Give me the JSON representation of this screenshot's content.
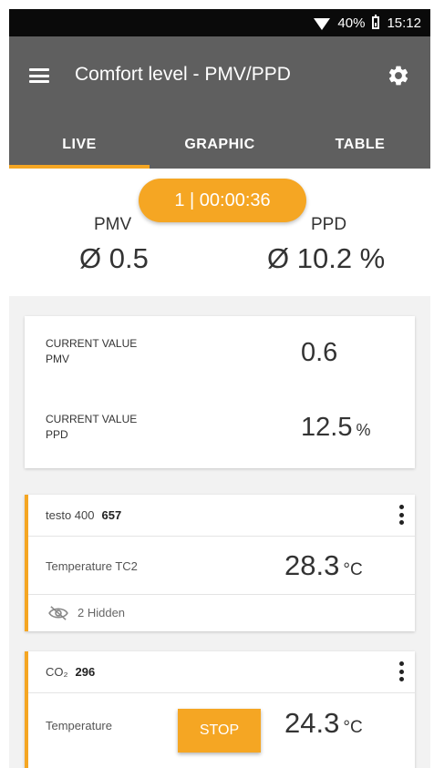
{
  "status_bar": {
    "battery": "40%",
    "time": "15:12"
  },
  "app_bar": {
    "title": "Comfort level - PMV/PPD"
  },
  "tabs": [
    {
      "label": "LIVE",
      "active": true
    },
    {
      "label": "GRAPHIC",
      "active": false
    },
    {
      "label": "TABLE",
      "active": false
    }
  ],
  "timer": "1 | 00:00:36",
  "summary": {
    "pmv_label": "PMV",
    "pmv_value": "Ø 0.5",
    "ppd_label": "PPD",
    "ppd_value": "Ø 10.2 %"
  },
  "current_values": {
    "pmv_label_line1": "CURRENT VALUE",
    "pmv_label_line2": "PMV",
    "pmv_value": "0.6",
    "ppd_label_line1": "CURRENT VALUE",
    "ppd_label_line2": "PPD",
    "ppd_value": "12.5",
    "ppd_unit": "%"
  },
  "probes": [
    {
      "name": "testo 400",
      "serial": "657",
      "measurement_label": "Temperature TC2",
      "measurement_value": "28.3",
      "unit": "°C",
      "hidden_text": "2 Hidden"
    },
    {
      "name": "CO₂",
      "serial": "296",
      "measurement_label": "Temperature",
      "measurement_value": "24.3",
      "unit": "°C"
    }
  ],
  "stop_label": "STOP",
  "colors": {
    "accent": "#f5a623",
    "app_bar": "#5f5f5f",
    "status_bar": "#0a0a0a"
  },
  "icons": [
    "wifi-icon",
    "battery-icon",
    "menu-icon",
    "gear-icon",
    "more-vert-icon",
    "eye-off-icon"
  ]
}
